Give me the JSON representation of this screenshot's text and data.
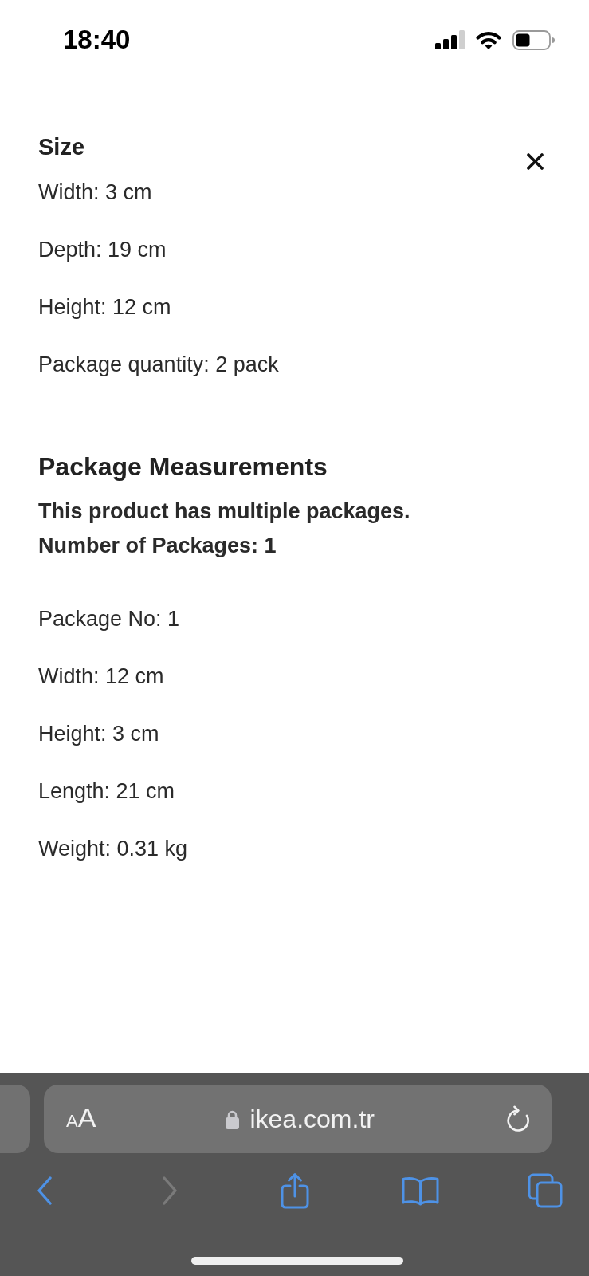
{
  "status_bar": {
    "time": "18:40"
  },
  "sheet": {
    "closable": true,
    "sections": [
      {
        "title": "Size",
        "rows": [
          "Width: 3 cm",
          "Depth: 19 cm",
          "Height: 12 cm",
          "Package quantity: 2 pack"
        ]
      },
      {
        "title": "Package Measurements",
        "notes": [
          "This product has multiple packages.",
          "Number of Packages: 1"
        ],
        "rows": [
          "Package No: 1",
          "Width: 12 cm",
          "Height: 3 cm",
          "Length: 21 cm",
          "Weight: 0.31 kg"
        ]
      }
    ]
  },
  "browser": {
    "text_size": "AA",
    "address": {
      "secure": true,
      "url": "ikea.com.tr"
    },
    "toolbar": [
      {
        "kind": "back",
        "disabled": false
      },
      {
        "kind": "forward",
        "disabled": true
      },
      {
        "kind": "share",
        "disabled": false
      },
      {
        "kind": "bookmarks",
        "disabled": false
      },
      {
        "kind": "tabs",
        "disabled": false
      }
    ]
  }
}
